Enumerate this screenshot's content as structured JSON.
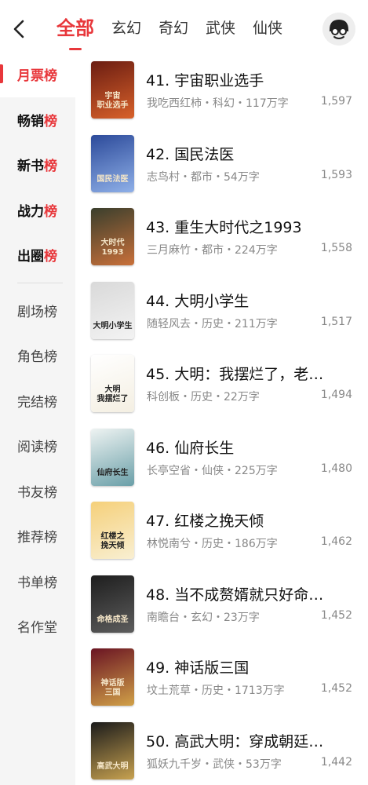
{
  "header": {
    "tabs": [
      {
        "label": "全部",
        "active": true
      },
      {
        "label": "玄幻"
      },
      {
        "label": "奇幻"
      },
      {
        "label": "武侠"
      },
      {
        "label": "仙侠"
      }
    ],
    "back_icon": "chevron-left-icon",
    "avatar_icon": "user-avatar-icon",
    "accent_color": "#e8373b"
  },
  "sidebar": {
    "items": [
      {
        "label": "月票榜"
      },
      {
        "label_main": "畅销",
        "label_hl": "榜"
      },
      {
        "label_main": "新书",
        "label_hl": "榜"
      },
      {
        "label_main": "战力",
        "label_hl": "榜"
      },
      {
        "label_main": "出圈",
        "label_hl": "榜"
      },
      {
        "label": "剧场榜"
      },
      {
        "label": "角色榜"
      },
      {
        "label": "完结榜"
      },
      {
        "label": "阅读榜"
      },
      {
        "label": "书友榜"
      },
      {
        "label": "推荐榜"
      },
      {
        "label": "书单榜"
      },
      {
        "label": "名作堂"
      }
    ]
  },
  "books": [
    {
      "title": "41. 宇宙职业选手",
      "meta": "我吃西红柿・科幻・117万字",
      "count": "1,597",
      "cover_text": "宇宙\n职业选手",
      "cover_colors": [
        "#6b1d12",
        "#d8612a"
      ]
    },
    {
      "title": "42. 国民法医",
      "meta": "志鸟村・都市・54万字",
      "count": "1,593",
      "cover_text": "国民法医",
      "cover_colors": [
        "#2c4a9a",
        "#8fb0e8"
      ]
    },
    {
      "title": "43. 重生大时代之1993",
      "meta": "三月麻竹・都市・224万字",
      "count": "1,558",
      "cover_text": "大时代1993",
      "cover_colors": [
        "#3a3f2d",
        "#c9703a"
      ]
    },
    {
      "title": "44. 大明小学生",
      "meta": "随轻风去・历史・211万字",
      "count": "1,517",
      "cover_text": "大明小学生",
      "cover_colors": [
        "#d9d9d9",
        "#f3f3f3"
      ]
    },
    {
      "title": "45. 大明：我摆烂了，老…",
      "meta": "科创板・历史・22万字",
      "count": "1,494",
      "cover_text": "大明\n我摆烂了",
      "cover_colors": [
        "#ffffff",
        "#f4efe2"
      ]
    },
    {
      "title": "46. 仙府长生",
      "meta": "长亭空省・仙侠・225万字",
      "count": "1,480",
      "cover_text": "仙府长生",
      "cover_colors": [
        "#eef3f2",
        "#6a9fa8"
      ]
    },
    {
      "title": "47. 红楼之挽天倾",
      "meta": "林悦南兮・历史・186万字",
      "count": "1,462",
      "cover_text": "红楼之\n挽天倾",
      "cover_colors": [
        "#f5d07a",
        "#f9efd2"
      ]
    },
    {
      "title": "48. 当不成赘婿就只好命…",
      "meta": "南瞻台・玄幻・23万字",
      "count": "1,452",
      "cover_text": "命格成圣",
      "cover_colors": [
        "#1e1e1e",
        "#5d5d5d"
      ]
    },
    {
      "title": "49. 神话版三国",
      "meta": "坟土荒草・历史・1713万字",
      "count": "1,452",
      "cover_text": "神话版\n三国",
      "cover_colors": [
        "#6a1423",
        "#d1a148"
      ]
    },
    {
      "title": "50. 高武大明：穿成朝廷…",
      "meta": "狐妖九千岁・武侠・53万字",
      "count": "1,442",
      "cover_text": "高武大明",
      "cover_colors": [
        "#1b1b1b",
        "#c8a250"
      ]
    }
  ]
}
